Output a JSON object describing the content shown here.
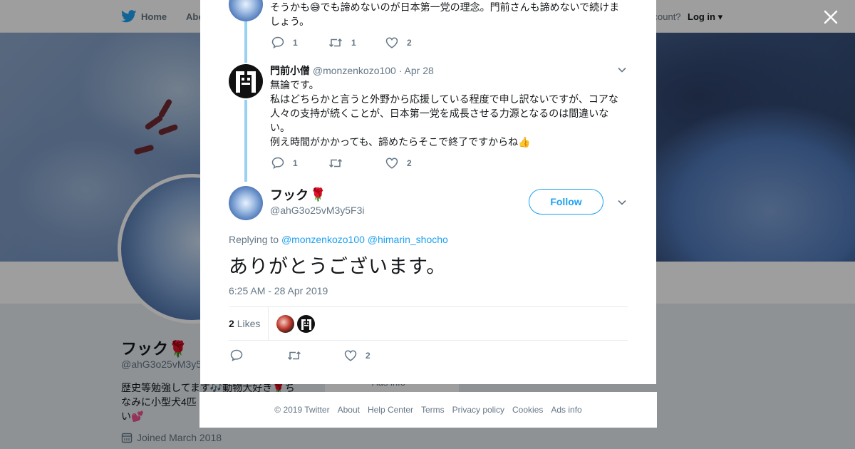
{
  "background": {
    "nav": {
      "home": "Home",
      "about": "Abo",
      "account_prompt": "ccount?",
      "login": "Log in"
    },
    "profile": {
      "name": "フック",
      "handle": "@ahG3o25vM3y5",
      "bio": "歴史等勉強してます🎶動物大好き🌹ちなみに小型犬4匹",
      "bio_tail": "い💕",
      "joined": "Joined March 2018",
      "more_info": "Ads info"
    }
  },
  "modal": {
    "tweet1": {
      "text_line1": "そうかも😅でも諦めないのが日本第一党の理念。門前さんも諦めないで続けま",
      "text_line2": "しょう。",
      "replies": "1",
      "retweets": "1",
      "likes": "2"
    },
    "tweet2": {
      "name": "門前小僧",
      "handle": "@monzenkozo100",
      "date": "· Apr 28",
      "lines": [
        "無論です。",
        "私はどちらかと言うと外野から応援している程度で申し訳ないですが、コアな",
        "人々の支持が続くことが、日本第一党を成長させる力源となるのは間違いな",
        "い。",
        "例え時間がかかっても、諦めたらそこで終了ですからね👍"
      ],
      "replies": "1",
      "likes": "2"
    },
    "focus": {
      "name": "フック",
      "name_emoji": "🌹",
      "handle": "@ahG3o25vM3y5F3i",
      "follow_label": "Follow",
      "replying_prefix": "Replying to",
      "replying_to": [
        "@monzenkozo100",
        "@himarin_shocho"
      ],
      "text": "ありがとうございます。",
      "timestamp": "6:25 AM - 28 Apr 2019",
      "likes_count": "2",
      "likes_label": "Likes",
      "action_likes": "2"
    }
  },
  "footer": {
    "copyright": "© 2019 Twitter",
    "links": [
      "About",
      "Help Center",
      "Terms",
      "Privacy policy",
      "Cookies",
      "Ads info"
    ]
  },
  "colors": {
    "accent": "#1da1f2",
    "thread_line": "#9ad0f2",
    "muted": "#657786"
  },
  "icons": [
    "twitter-bird-icon",
    "reply-icon",
    "retweet-icon",
    "heart-icon",
    "chevron-down-icon",
    "close-icon",
    "calendar-icon"
  ]
}
